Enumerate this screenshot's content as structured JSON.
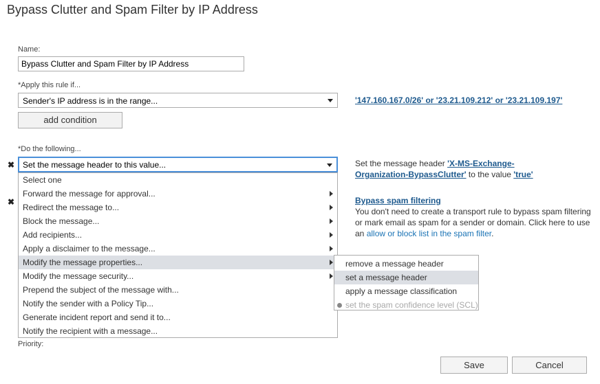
{
  "title": "Bypass Clutter and Spam Filter by IP Address",
  "name_label": "Name:",
  "name_value": "Bypass Clutter and Spam Filter by IP Address",
  "apply_label": "*Apply this rule if...",
  "condition_select": "Sender's IP address is in the range...",
  "condition_value_link": "'147.160.167.0/26' or '23.21.109.212' or '23.21.109.197'",
  "add_condition": "add condition",
  "do_label": "*Do the following...",
  "action_select": "Set the message header to this value...",
  "action1_desc": {
    "prefix": "Set the message header ",
    "header_link": "'X-MS-Exchange-Organization-BypassClutter'",
    "middle": " to the value ",
    "value_link": "'true'"
  },
  "action2_desc": {
    "link": "Bypass spam filtering",
    "text1": "You don't need to create a transport rule to bypass spam filtering or mark email as spam for a sender or domain. Click here to use",
    "text_prefix": "an ",
    "spam_link": "allow or block list in the spam filter",
    "text_suffix": "."
  },
  "remove_icon": "✖",
  "dropdown_items": [
    {
      "label": "Select one",
      "submenu": false
    },
    {
      "label": "Forward the message for approval...",
      "submenu": true
    },
    {
      "label": "Redirect the message to...",
      "submenu": true
    },
    {
      "label": "Block the message...",
      "submenu": true
    },
    {
      "label": "Add recipients...",
      "submenu": true
    },
    {
      "label": "Apply a disclaimer to the message...",
      "submenu": true
    },
    {
      "label": "Modify the message properties...",
      "submenu": true
    },
    {
      "label": "Modify the message security...",
      "submenu": true
    },
    {
      "label": "Prepend the subject of the message with...",
      "submenu": false
    },
    {
      "label": "Notify the sender with a Policy Tip...",
      "submenu": false
    },
    {
      "label": "Generate incident report and send it to...",
      "submenu": false
    },
    {
      "label": "Notify the recipient with a message...",
      "submenu": false
    }
  ],
  "submenu_items": [
    {
      "label": "remove a message header",
      "disabled": false
    },
    {
      "label": "set a message header",
      "disabled": false
    },
    {
      "label": "apply a message classification",
      "disabled": false
    },
    {
      "label": "set the spam confidence level (SCL)",
      "disabled": true
    }
  ],
  "priority_label": "Priority:",
  "save": "Save",
  "cancel": "Cancel"
}
